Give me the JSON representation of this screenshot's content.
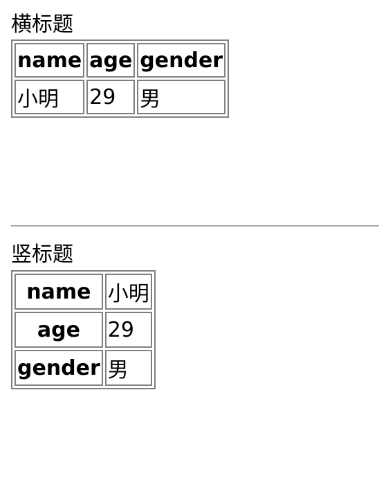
{
  "horizontal_section": {
    "title": "横标题",
    "headers": [
      "name",
      "age",
      "gender"
    ],
    "row": [
      "小明",
      "29",
      "男"
    ]
  },
  "vertical_section": {
    "title": "竖标题",
    "rows": [
      {
        "header": "name",
        "value": "小明"
      },
      {
        "header": "age",
        "value": "29"
      },
      {
        "header": "gender",
        "value": "男"
      }
    ]
  }
}
